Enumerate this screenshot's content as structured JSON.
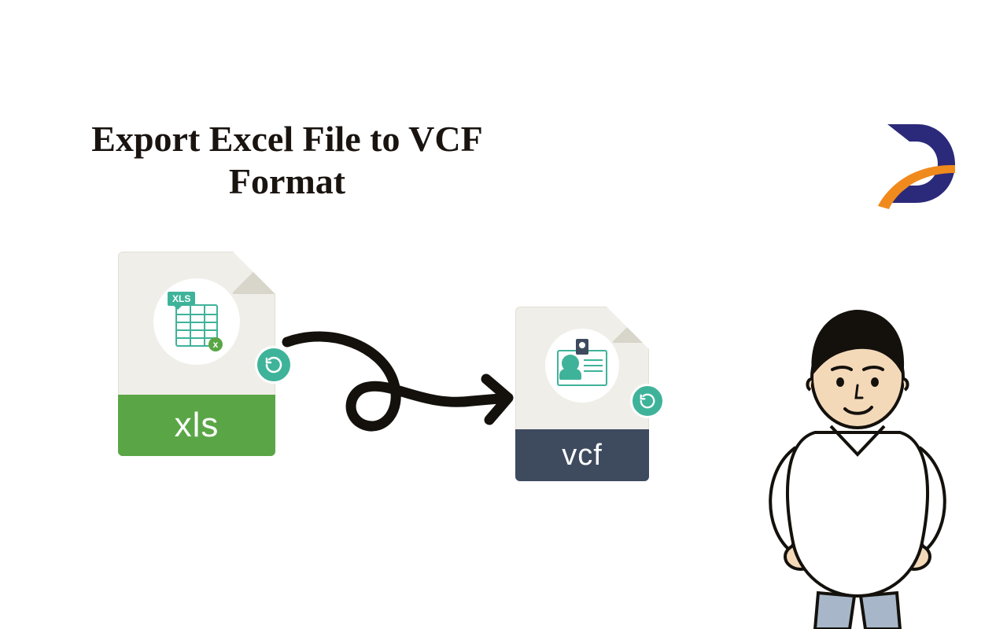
{
  "headline": "Export Excel File to VCF Format",
  "files": {
    "xls": {
      "label": "xls",
      "tag": "XLS",
      "x_mark": "x"
    },
    "vcf": {
      "label": "vcf"
    }
  },
  "logo_letter": "D",
  "icon_names": {
    "refresh": "refresh-icon",
    "arrow": "curly-arrow-icon",
    "logo": "d-logo-icon",
    "person": "cartoon-person-icon"
  },
  "colors": {
    "xls_green": "#5aa646",
    "vcf_slate": "#3e4a5e",
    "teal": "#3fb39a",
    "logo_navy": "#2b2a7a",
    "logo_orange": "#f08a1d",
    "ink": "#1a1410"
  }
}
